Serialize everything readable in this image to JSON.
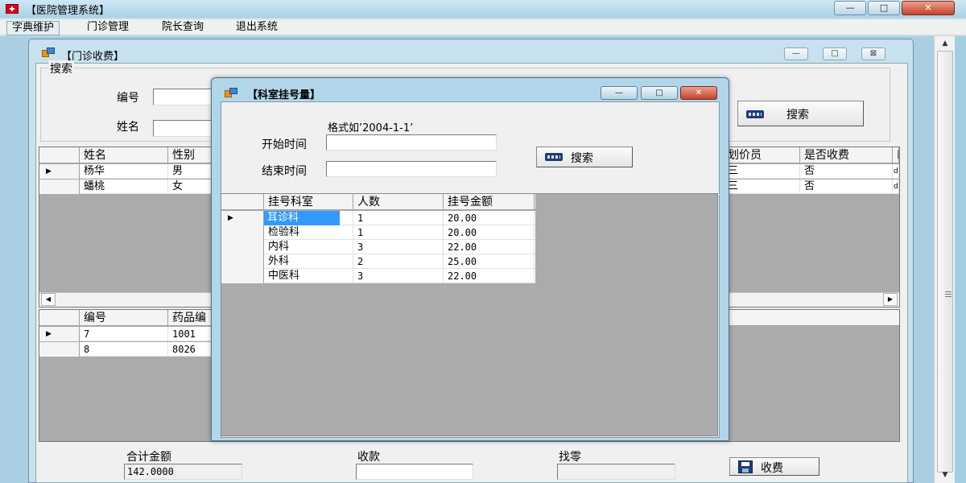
{
  "app": {
    "title": "【医院管理系统】",
    "window_buttons": {
      "minimize": "—",
      "maximize": "□",
      "close": "✕"
    }
  },
  "menu": {
    "items": [
      "字典维护",
      "门诊管理",
      "院长查询",
      "退出系统"
    ]
  },
  "outpatient": {
    "title": "【门诊收费】",
    "window_buttons": {
      "minimize": "—",
      "maximize": "□",
      "close": "⊠"
    },
    "search_group_label": "搜索",
    "id_label": "编号",
    "name_label": "姓名",
    "search_button": "搜索",
    "patients": {
      "columns": [
        "姓名",
        "性别",
        "",
        "划价员",
        "是否收费",
        "L"
      ],
      "rows": [
        {
          "name": "杨华",
          "gender": "男",
          "pricer": "三",
          "charged": "否",
          "extra": "d"
        },
        {
          "name": "蟠桃",
          "gender": "女",
          "pricer": "三",
          "charged": "否",
          "extra": "d"
        }
      ]
    },
    "details": {
      "columns": [
        "编号",
        "药品编"
      ],
      "rows": [
        {
          "id": "7",
          "code": "1001"
        },
        {
          "id": "8",
          "code": "8026"
        }
      ]
    },
    "total_label": "合计金额",
    "total_value": "142.0000",
    "received_label": "收款",
    "received_value": "",
    "change_label": "找零",
    "change_value": "",
    "charge_button": "收费"
  },
  "registration": {
    "title": "【科室挂号量】",
    "window_buttons": {
      "minimize": "—",
      "maximize": "□",
      "close": "✕"
    },
    "format_hint": "格式如’2004-1-1’",
    "start_label": "开始时间",
    "end_label": "结束时间",
    "start_value": "",
    "end_value": "",
    "search_button": "搜索",
    "columns": [
      "挂号科室",
      "人数",
      "挂号金额"
    ],
    "rows": [
      {
        "dept": "耳诊科",
        "count": "1",
        "amount": "20.00"
      },
      {
        "dept": "检验科",
        "count": "1",
        "amount": "20.00"
      },
      {
        "dept": "内科",
        "count": "3",
        "amount": "22.00"
      },
      {
        "dept": "外科",
        "count": "2",
        "amount": "25.00"
      },
      {
        "dept": "中医科",
        "count": "3",
        "amount": "22.00"
      }
    ]
  }
}
